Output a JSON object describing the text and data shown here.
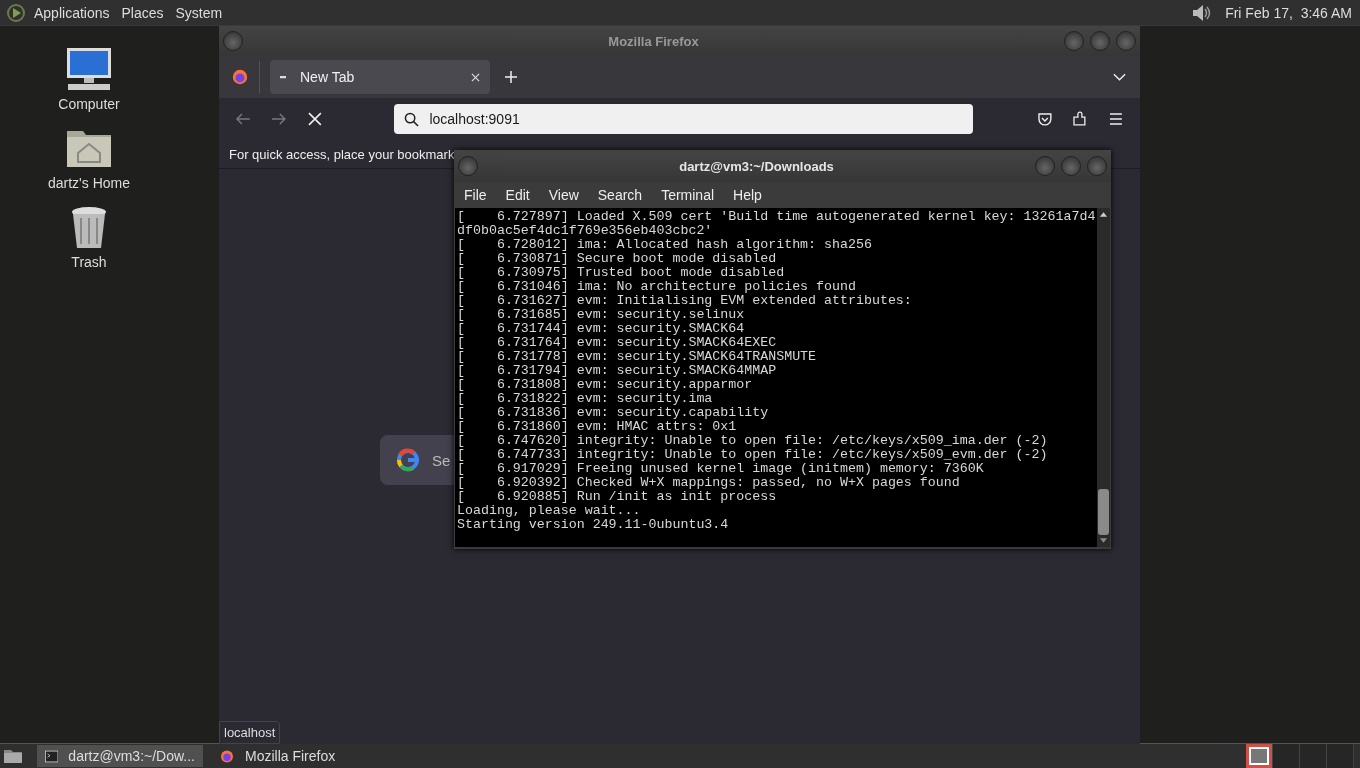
{
  "top_panel": {
    "menus": [
      "Applications",
      "Places",
      "System"
    ],
    "clock": "Fri Feb 17,  3:46 AM"
  },
  "desktop_icons": [
    {
      "label": "Computer",
      "kind": "computer"
    },
    {
      "label": "dartz's Home",
      "kind": "home"
    },
    {
      "label": "Trash",
      "kind": "trash"
    }
  ],
  "firefox": {
    "title": "Mozilla Firefox",
    "tabs": [
      {
        "label": "New Tab",
        "selected": true
      }
    ],
    "address": "localhost:9091",
    "bookmarks_hint": "For quick access, place your bookmark",
    "search": {
      "placeholder": "Se"
    },
    "status": "localhost"
  },
  "terminal": {
    "title": "dartz@vm3:~/Downloads",
    "menus": [
      "File",
      "Edit",
      "View",
      "Search",
      "Terminal",
      "Help"
    ],
    "lines": [
      "[    6.727897] Loaded X.509 cert 'Build time autogenerated kernel key: 13261a7d4",
      "df0b0ac5ef4dc1f769e356eb403cbc2'",
      "[    6.728012] ima: Allocated hash algorithm: sha256",
      "[    6.730871] Secure boot mode disabled",
      "[    6.730975] Trusted boot mode disabled",
      "[    6.731046] ima: No architecture policies found",
      "[    6.731627] evm: Initialising EVM extended attributes:",
      "[    6.731685] evm: security.selinux",
      "[    6.731744] evm: security.SMACK64",
      "[    6.731764] evm: security.SMACK64EXEC",
      "[    6.731778] evm: security.SMACK64TRANSMUTE",
      "[    6.731794] evm: security.SMACK64MMAP",
      "[    6.731808] evm: security.apparmor",
      "[    6.731822] evm: security.ima",
      "[    6.731836] evm: security.capability",
      "[    6.731860] evm: HMAC attrs: 0x1",
      "[    6.747620] integrity: Unable to open file: /etc/keys/x509_ima.der (-2)",
      "[    6.747733] integrity: Unable to open file: /etc/keys/x509_evm.der (-2)",
      "[    6.917029] Freeing unused kernel image (initmem) memory: 7360K",
      "[    6.920392] Checked W+X mappings: passed, no W+X pages found",
      "[    6.920885] Run /init as init process",
      "Loading, please wait...",
      "Starting version 249.11-0ubuntu3.4"
    ]
  },
  "taskbar": {
    "tasks": [
      {
        "label": "dartz@vm3:~/Dow...",
        "kind": "terminal",
        "selected": true
      },
      {
        "label": "Mozilla Firefox",
        "kind": "firefox",
        "selected": false
      }
    ],
    "workspaces": [
      {
        "selected": true
      },
      {
        "selected": false
      },
      {
        "selected": false
      },
      {
        "selected": false
      }
    ]
  }
}
